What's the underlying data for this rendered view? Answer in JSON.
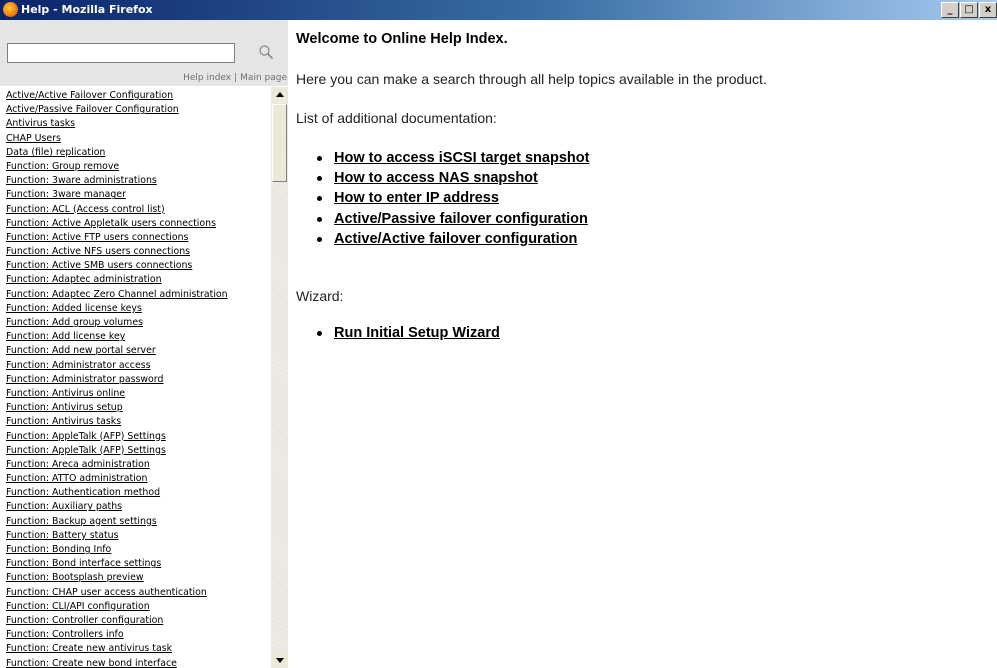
{
  "window": {
    "title": "Help - Mozilla Firefox",
    "buttons": {
      "minimize": "_",
      "maximize": "□",
      "close": "x"
    }
  },
  "sidebar": {
    "search": {
      "value": "",
      "placeholder": ""
    },
    "nav": {
      "help_index": "Help index",
      "separator": "|",
      "main_page": "Main page"
    },
    "topics": [
      "Active/Active Failover Configuration",
      "Active/Passive Failover Configuration",
      "Antivirus tasks",
      "CHAP Users",
      "Data (file) replication",
      "Function:  Group remove",
      "Function: 3ware administrations",
      "Function: 3ware manager",
      "Function: ACL (Access control list)",
      "Function: Active Appletalk users connections",
      "Function: Active FTP users connections",
      "Function: Active NFS users connections",
      "Function: Active SMB users connections",
      "Function: Adaptec administration",
      "Function: Adaptec Zero Channel administration",
      "Function: Added license keys",
      "Function: Add group volumes",
      "Function: Add license key",
      "Function: Add new portal server",
      "Function: Administrator access",
      "Function: Administrator password",
      "Function: Antivirus online",
      "Function: Antivirus setup",
      "Function: Antivirus tasks",
      "Function: AppleTalk (AFP) Settings",
      "Function: AppleTalk (AFP) Settings",
      "Function: Areca administration",
      "Function: ATTO administration",
      "Function: Authentication method",
      "Function: Auxiliary paths",
      "Function: Backup agent settings",
      "Function: Battery status",
      "Function: Bonding Info",
      "Function: Bond interface settings",
      "Function: Bootsplash preview",
      "Function: CHAP user access authentication",
      "Function: CLI/API configuration",
      "Function: Controller configuration",
      "Function: Controllers info",
      "Function: Create new antivirus task",
      "Function: Create new bond interface"
    ]
  },
  "main": {
    "title": "Welcome to Online Help Index.",
    "intro": "Here you can make a search through all help topics available in the product.",
    "docs_heading": "List of additional documentation:",
    "docs": [
      "How to access iSCSI target snapshot",
      "How to access NAS snapshot",
      "How to enter IP address",
      "Active/Passive failover configuration",
      "Active/Active failover configuration"
    ],
    "wizard_heading": "Wizard:",
    "wizards": [
      "Run Initial Setup Wizard"
    ]
  },
  "icons": {
    "app": "firefox-icon",
    "search": "magnifier-icon"
  }
}
